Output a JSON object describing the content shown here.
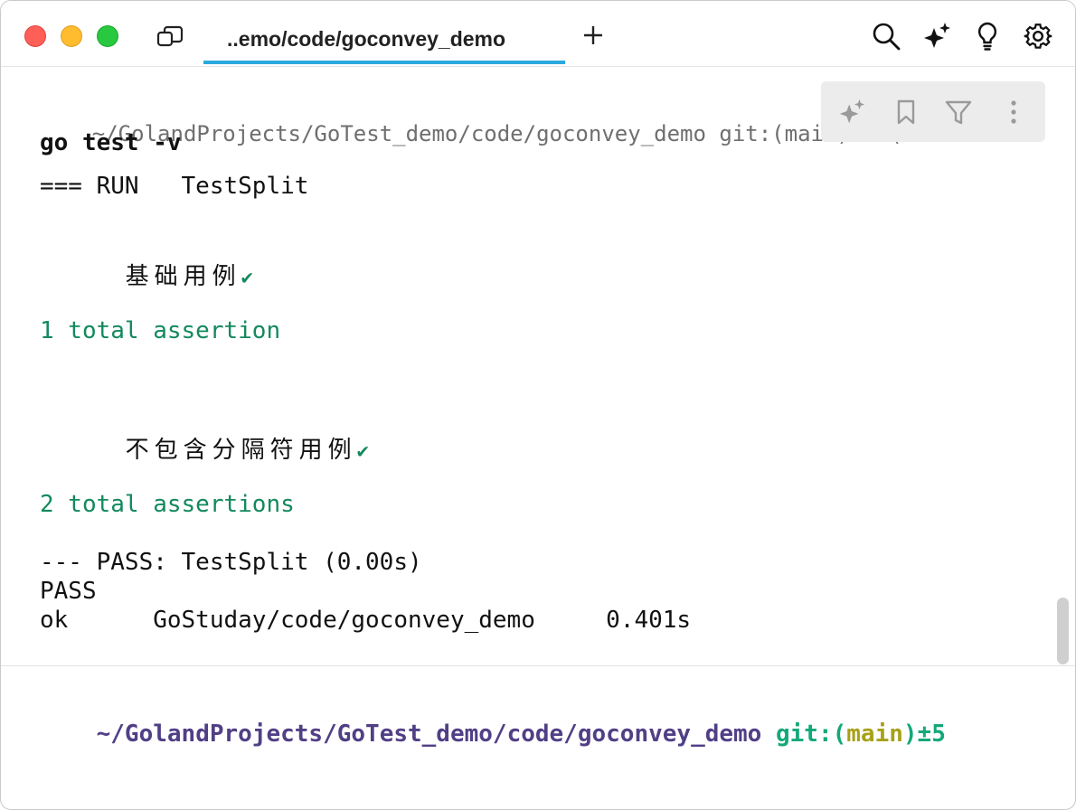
{
  "tab": {
    "title": "..emo/code/goconvey_demo"
  },
  "toolbar_top": {
    "icons": [
      "search-icon",
      "sparkle-icon",
      "lightbulb-icon",
      "gear-icon"
    ]
  },
  "floating_toolbar": {
    "icons": [
      "sparkle-icon",
      "bookmark-icon",
      "filter-icon",
      "more-vertical-icon"
    ]
  },
  "terminal": {
    "prompt_path": "~/GolandProjects/GoTest_demo/code/goconvey_demo",
    "prompt_git": " git:(main)±5 (",
    "command": "go test -v",
    "run_line": "=== RUN   TestSplit",
    "case1": "基础用例",
    "check": "✔",
    "assert1": "1 total assertion",
    "case2": "不包含分隔符用例",
    "assert2": "2 total assertions",
    "pass_line": "--- PASS: TestSplit (0.00s)",
    "pass": "PASS",
    "ok_line": "ok      GoStuday/code/goconvey_demo     0.401s"
  },
  "prompt": {
    "path": "~/GolandProjects/GoTest_demo/code/goconvey_demo",
    "git_prefix": " git:(",
    "branch": "main",
    "git_suffix": ")±5"
  },
  "colors": {
    "accent_tab": "#2aa9dc",
    "success_green": "#128a5d",
    "prompt_purple": "#513f86",
    "git_green": "#13a87a",
    "branch_olive": "#a7a118"
  }
}
